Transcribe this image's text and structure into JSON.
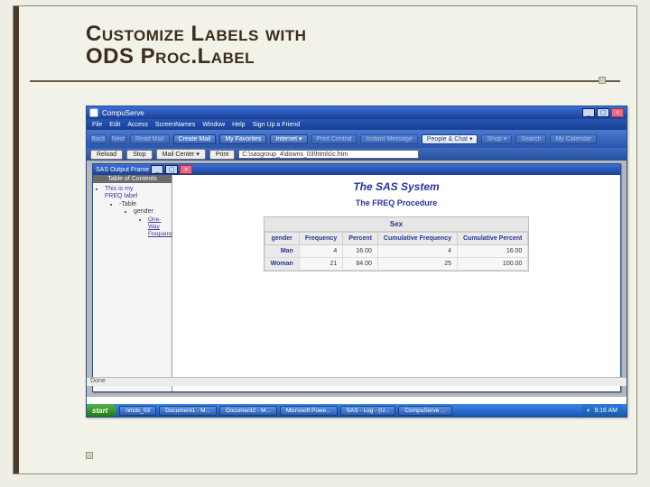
{
  "slide": {
    "title_line1": "Customize Labels with",
    "title_line2": "ODS Proc.Label"
  },
  "browser": {
    "app_title": "CompuServe",
    "menus": [
      "File",
      "Edit",
      "Access",
      "ScreenNames",
      "Window",
      "Help",
      "Sign Up a Friend"
    ],
    "nav": {
      "back": "Back",
      "next": "Next"
    },
    "toolbar": [
      {
        "label": "Read Mail"
      },
      {
        "label": "Create Mail"
      },
      {
        "label": "My Favorites"
      },
      {
        "label": "Internet ▾"
      },
      {
        "label": "Print Central"
      },
      {
        "label": "Instant Message"
      },
      {
        "label": "People & Chat ▾"
      },
      {
        "label": "Shop ▾"
      },
      {
        "label": "Search"
      },
      {
        "label": "My Calendar"
      }
    ],
    "addrbar": {
      "reload": "Reload",
      "stop": "Stop",
      "mailcenter": "Mail Center ▾",
      "print": "Print",
      "url": "C:\\sasgroup_4\\downs_03\\htmls\\c.htm"
    },
    "people_chat_highlight": "People & Chat"
  },
  "inner_window": {
    "title": "SAS Output Frame"
  },
  "toc": {
    "header": "Table of Contents",
    "line1": "This is my",
    "line2": "FREQ label",
    "table_label": "Table",
    "var_label": "gender",
    "link": "One-Way Frequencies"
  },
  "report": {
    "system_title": "The SAS System",
    "proc_title": "The FREQ Procedure",
    "table_caption": "Sex",
    "columns": [
      "gender",
      "Frequency",
      "Percent",
      "Cumulative Frequency",
      "Cumulative Percent"
    ],
    "rows": [
      {
        "label": "Man",
        "freq": "4",
        "pct": "16.00",
        "cfreq": "4",
        "cpct": "16.00"
      },
      {
        "label": "Woman",
        "freq": "21",
        "pct": "84.00",
        "cfreq": "25",
        "cpct": "100.00"
      }
    ]
  },
  "statusbar": {
    "text": "Done"
  },
  "taskbar": {
    "start": "start",
    "items": [
      "nmds_03",
      "Document1 - M...",
      "Document2 - M...",
      "Microsoft Powe...",
      "SAS - Log - (U...",
      "CompuServe ..."
    ],
    "clock": "9:16 AM"
  }
}
